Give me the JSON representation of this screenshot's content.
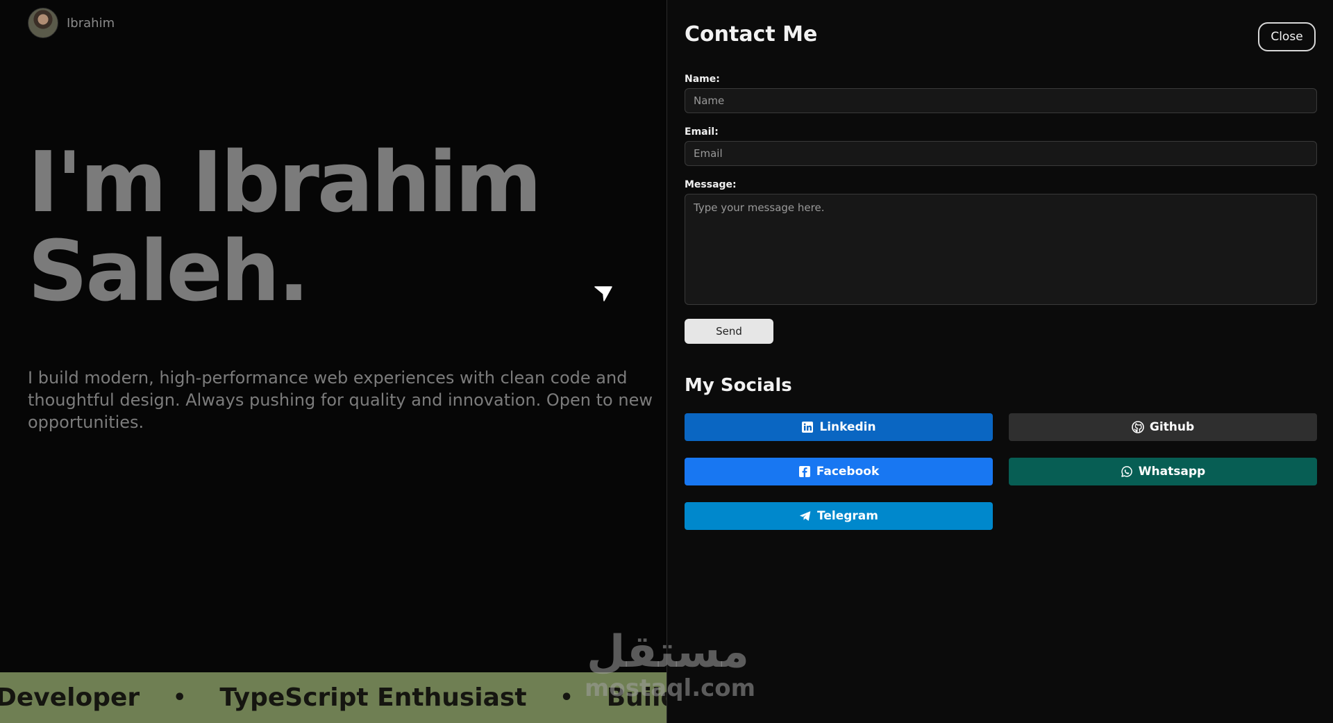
{
  "header": {
    "brand_name": "Ibrahim"
  },
  "hero": {
    "title_line1": "I'm Ibrahim",
    "title_line2": "Saleh.",
    "description": "I build modern, high-performance web experiences with clean code and thoughtful design. Always pushing for quality and innovation. Open to new opportunities."
  },
  "marquee": {
    "items": [
      "s Developer",
      "TypeScript Enthusiast",
      "Building"
    ],
    "separator": "•"
  },
  "watermark": {
    "arabic": "مستقل",
    "latin": "mostaql.com"
  },
  "contact": {
    "title": "Contact Me",
    "close_label": "Close",
    "name_label": "Name:",
    "name_placeholder": "Name",
    "email_label": "Email:",
    "email_placeholder": "Email",
    "message_label": "Message:",
    "message_placeholder": "Type your message here.",
    "send_label": "Send"
  },
  "socials": {
    "title": "My Socials",
    "items": [
      {
        "label": "Linkedin",
        "icon": "linkedin-icon",
        "color": "#0a66c2"
      },
      {
        "label": "Github",
        "icon": "github-icon",
        "color": "#2f2f2f"
      },
      {
        "label": "Facebook",
        "icon": "facebook-icon",
        "color": "#1877f2"
      },
      {
        "label": "Whatsapp",
        "icon": "whatsapp-icon",
        "color": "#075e54"
      },
      {
        "label": "Telegram",
        "icon": "telegram-icon",
        "color": "#0088cc"
      }
    ]
  }
}
